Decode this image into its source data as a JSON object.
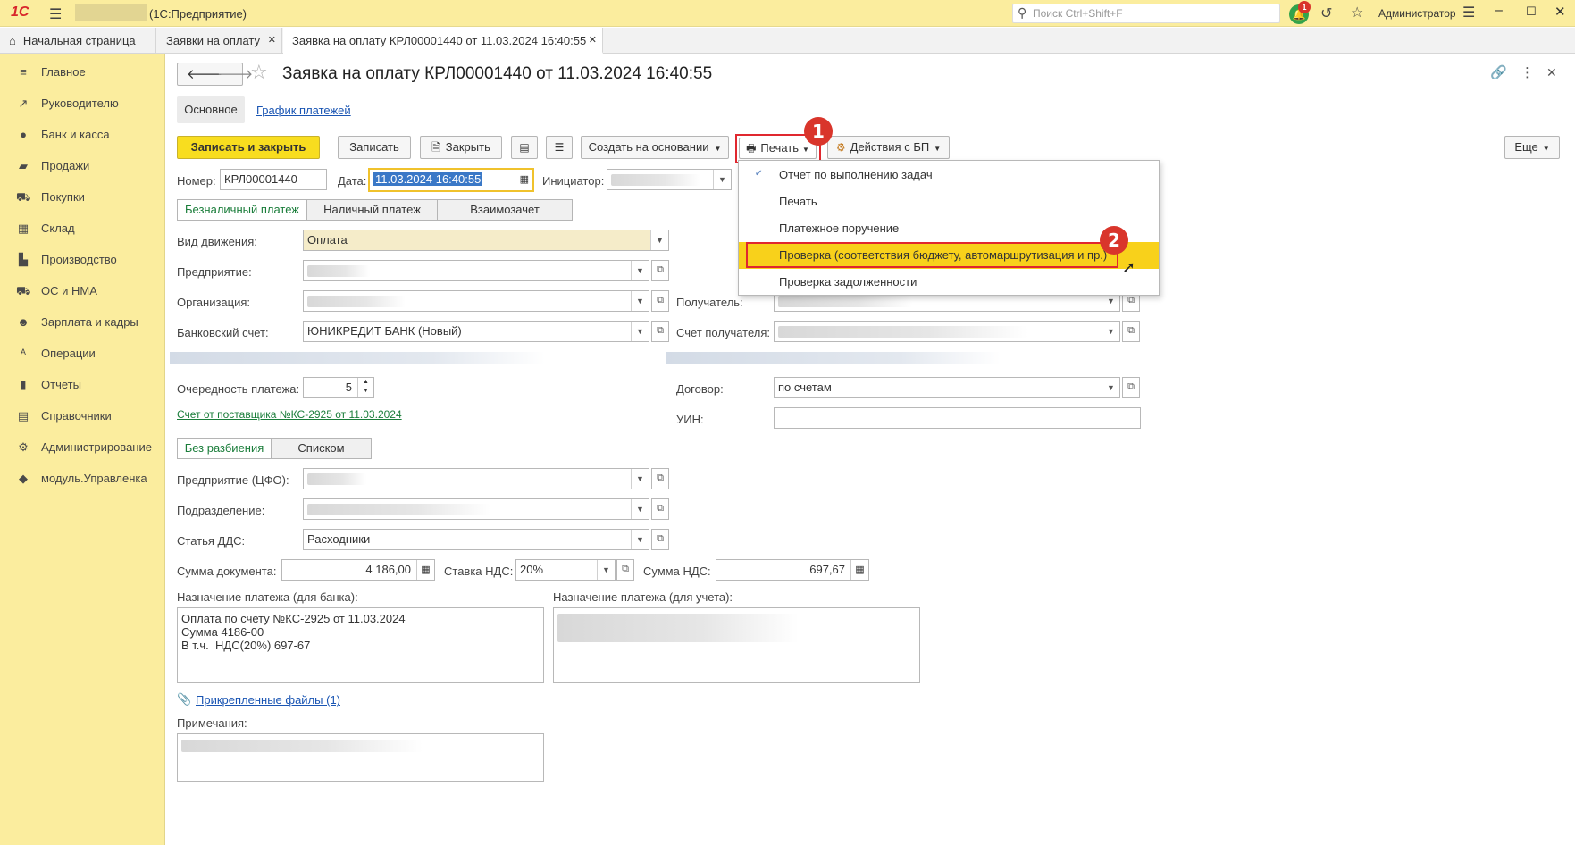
{
  "app": {
    "logo": "1С",
    "title": "(1С:Предприятие)",
    "search_placeholder": "Поиск Ctrl+Shift+F",
    "notif_count": "1",
    "user": "Администратор"
  },
  "tabs": [
    {
      "label": "Начальная страница"
    },
    {
      "label": "Заявки на оплату"
    },
    {
      "label": "Заявка на оплату КРЛ00001440 от 11.03.2024 16:40:55"
    }
  ],
  "sidebar": {
    "items": [
      {
        "label": "Главное",
        "icon": "menu-icon"
      },
      {
        "label": "Руководителю",
        "icon": "chart-line-icon"
      },
      {
        "label": "Банк и касса",
        "icon": "coins-icon"
      },
      {
        "label": "Продажи",
        "icon": "bag-icon"
      },
      {
        "label": "Покупки",
        "icon": "cart-icon"
      },
      {
        "label": "Склад",
        "icon": "warehouse-icon"
      },
      {
        "label": "Производство",
        "icon": "factory-icon"
      },
      {
        "label": "ОС и НМА",
        "icon": "truck-icon"
      },
      {
        "label": "Зарплата и кадры",
        "icon": "person-icon"
      },
      {
        "label": "Операции",
        "icon": "dt-kt-icon"
      },
      {
        "label": "Отчеты",
        "icon": "bar-chart-icon"
      },
      {
        "label": "Справочники",
        "icon": "book-icon"
      },
      {
        "label": "Администрирование",
        "icon": "gear-icon"
      },
      {
        "label": "модуль.Управленка",
        "icon": "cube-icon"
      }
    ]
  },
  "form": {
    "title": "Заявка на оплату КРЛ00001440 от 11.03.2024 16:40:55",
    "subtabs": {
      "main": "Основное",
      "schedule": "График платежей"
    },
    "toolbar": {
      "save_close": "Записать и закрыть",
      "save": "Записать",
      "close": "Закрыть",
      "create_based": "Создать на основании",
      "print": "Печать",
      "bp_actions": "Действия с БП",
      "more": "Еще"
    },
    "number_label": "Номер:",
    "number_value": "КРЛ00001440",
    "date_label": "Дата:",
    "date_value": "11.03.2024 16:40:55",
    "initiator_label": "Инициатор:",
    "payment_types": [
      "Безналичный платеж",
      "Наличный платеж",
      "Взаимозачет"
    ],
    "movement_label": "Вид движения:",
    "movement_value": "Оплата",
    "enterprise_label": "Предприятие:",
    "organization_label": "Организация:",
    "bank_account_label": "Банковский счет:",
    "bank_account_value": "ЮНИКРЕДИТ БАНК (Новый)",
    "recipient_label": "Получатель:",
    "recipient_account_label": "Счет получателя:",
    "priority_label": "Очередность платежа:",
    "priority_value": "5",
    "supplier_invoice_link": "Счет от поставщика №КС-2925 от 11.03.2024",
    "contract_label": "Договор:",
    "contract_value": "по счетам",
    "uin_label": "УИН:",
    "split_modes": [
      "Без разбиения",
      "Списком"
    ],
    "cfo_label": "Предприятие (ЦФО):",
    "division_label": "Подразделение:",
    "dds_label": "Статья ДДС:",
    "dds_value": "Расходники",
    "doc_sum_label": "Сумма документа:",
    "doc_sum_value": "4 186,00",
    "vat_rate_label": "Ставка НДС:",
    "vat_rate_value": "20%",
    "vat_sum_label": "Сумма НДС:",
    "vat_sum_value": "697,67",
    "purpose_bank_label": "Назначение платежа (для банка):",
    "purpose_bank_value": "Оплата по счету №КС-2925 от 11.03.2024\nСумма 4186-00\nВ т.ч.  НДС(20%) 697-67",
    "purpose_acc_label": "Назначение платежа (для учета):",
    "attachments_link": "Прикрепленные файлы (1)",
    "notes_label": "Примечания:"
  },
  "print_menu": {
    "items": [
      "Отчет по выполнению задач",
      "Печать",
      "Платежное поручение",
      "Проверка (соответствия бюджету, автомаршрутизация и пр.)",
      "Проверка задолженности"
    ],
    "highlighted_index": 3
  },
  "annotations": {
    "step1": "1",
    "step2": "2"
  },
  "colors": {
    "accent": "#f8dd1f",
    "sidebar": "#fbed9e",
    "highlight": "#f8d11b",
    "callout": "#d9352b"
  }
}
